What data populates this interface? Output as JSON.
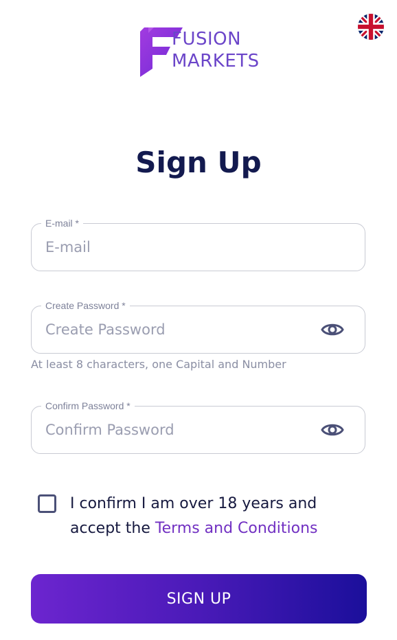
{
  "brand": {
    "line1": "FUSION",
    "line2": "MARKETS",
    "accent_color": "#6b45c9",
    "logo_icon": "fusion-markets-f-logo"
  },
  "language": {
    "icon": "uk-flag-icon"
  },
  "title": "Sign Up",
  "form": {
    "email": {
      "label": "E-mail *",
      "placeholder": "E-mail",
      "value": ""
    },
    "password": {
      "label": "Create Password *",
      "placeholder": "Create Password",
      "value": "",
      "toggle_icon": "eye-icon",
      "hint": "At least 8 characters, one Capital and Number"
    },
    "confirm_password": {
      "label": "Confirm Password *",
      "placeholder": "Confirm Password",
      "value": "",
      "toggle_icon": "eye-icon"
    },
    "consent": {
      "checked": false,
      "text": "I confirm I am over 18 years and accept the ",
      "link_text": "Terms and Conditions"
    },
    "submit_label": "SIGN UP"
  },
  "colors": {
    "heading": "#131a4f",
    "link": "#7130c2",
    "button_gradient_start": "#6c25cf",
    "button_gradient_end": "#1b0f9b"
  }
}
